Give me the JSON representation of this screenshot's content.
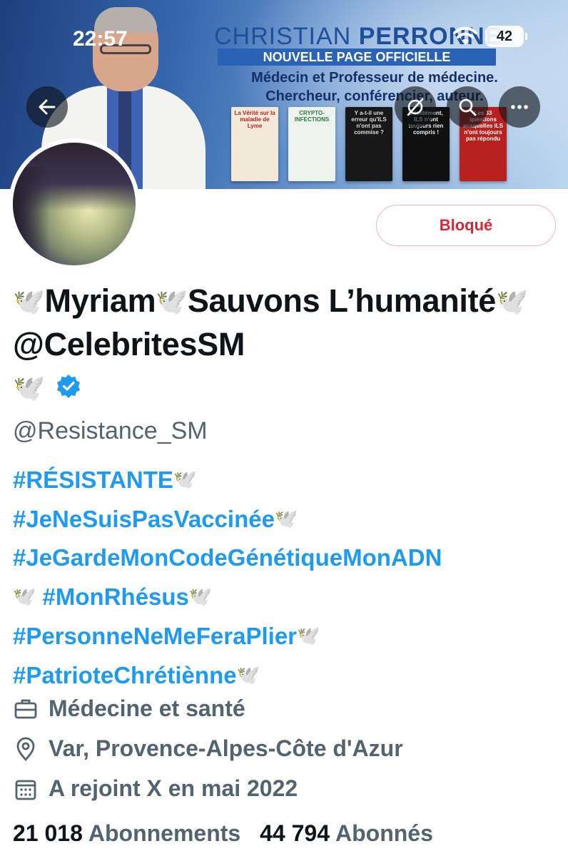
{
  "status_bar": {
    "time": "22:57",
    "battery": "42"
  },
  "banner": {
    "title_light": "CHRISTIAN ",
    "title_bold": "PERRONNE",
    "subtitle": "NOUVELLE PAGE OFFICIELLE",
    "description_line1": "Médecin et Professeur de médecine.",
    "description_line2": "Chercheur, conférencier, auteur.",
    "books": [
      "La Vérité sur la maladie de Lyme",
      "CRYPTO-INFECTIONS",
      "Y a-t-il une erreur qu'ILS n'ont pas commise ?",
      "Décidément, ILS n'ont toujours rien compris !",
      "Les 33 questions auxquelles ILS n'ont toujours pas répondu"
    ]
  },
  "actions": {
    "back": "back-arrow-icon",
    "translate": "translate-off-icon",
    "search": "search-icon",
    "more": "more-icon"
  },
  "profile": {
    "blocked_label": "Bloqué",
    "name_part1": "Myriam",
    "name_part2": "Sauvons L’humanité",
    "name_part3": "@CelebritesSM",
    "dove": "🕊️",
    "handle": "@Resistance_SM",
    "bio": [
      "#RÉSISTANTE",
      "#JeNeSuisPasVaccinée",
      "#JeGardeMonCodeGénétiqueMonADN",
      "#MonRhésus",
      "#PersonneNeMeFeraPlier",
      "#PatrioteChrétiènne"
    ],
    "category": "Médecine et santé",
    "location": "Var, Provence-Alpes-Côte d'Azur",
    "joined": "A rejoint X en mai 2022",
    "following_count": "21 018",
    "following_label": "Abonnements",
    "followers_count": "44 794",
    "followers_label": "Abonnés"
  },
  "colors": {
    "link": "#1d9bf0",
    "muted": "#536471",
    "blocked": "#dc2638",
    "verified": "#1d9bf0"
  }
}
